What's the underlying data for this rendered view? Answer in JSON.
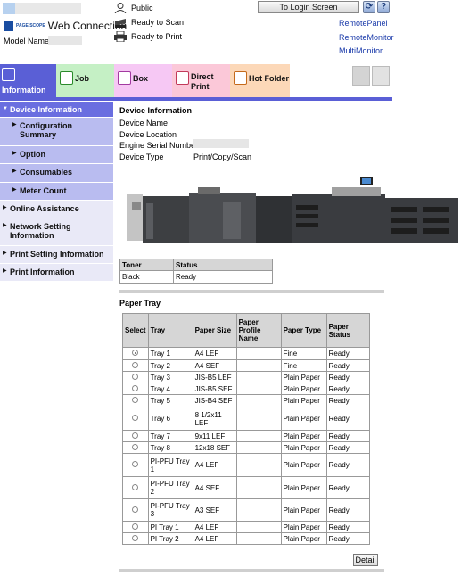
{
  "header": {
    "app_name": "Web Connection",
    "logo_small": "PAGE SCOPE",
    "model_label": "Model Name:",
    "user_status": "Public",
    "ready_scan": "Ready to Scan",
    "ready_print": "Ready to Print",
    "login_button": "To Login Screen",
    "links": [
      "RemotePanel",
      "RemoteMonitor",
      "MultiMonitor"
    ]
  },
  "tabs": [
    {
      "label": "Information",
      "icon": "information-icon",
      "color": "#5a5fd6"
    },
    {
      "label": "Job",
      "icon": "job-icon",
      "color": "#c5f0c5"
    },
    {
      "label": "Box",
      "icon": "box-icon",
      "color": "#f6c8f4"
    },
    {
      "label": "Direct Print",
      "line1": "Direct",
      "line2": "Print",
      "icon": "direct-print-icon",
      "color": "#fbc8d8"
    },
    {
      "label": "Hot Folder",
      "icon": "hot-folder-icon",
      "color": "#fcd8b8"
    }
  ],
  "sidebar": {
    "items": [
      {
        "label": "Device Information"
      },
      {
        "label": "Configuration Summary"
      },
      {
        "label": "Option"
      },
      {
        "label": "Consumables"
      },
      {
        "label": "Meter Count"
      },
      {
        "label": "Online Assistance"
      },
      {
        "label": "Network Setting Information"
      },
      {
        "label": "Print Setting Information"
      },
      {
        "label": "Print Information"
      }
    ]
  },
  "device": {
    "title": "Device Information",
    "name_label": "Device Name",
    "location_label": "Device Location",
    "serial_label": "Engine Serial Number",
    "type_label": "Device Type",
    "type_value": "Print/Copy/Scan"
  },
  "toner": {
    "headers": [
      "Toner",
      "Status"
    ],
    "rows": [
      [
        "Black",
        "Ready"
      ]
    ]
  },
  "paper_tray": {
    "title": "Paper Tray",
    "headers": [
      "Select",
      "Tray",
      "Paper Size",
      "Paper Profile Name",
      "Paper Type",
      "Paper Status"
    ],
    "rows": [
      {
        "selected": true,
        "tray": "Tray 1",
        "size": "A4 LEF",
        "profile": "",
        "type": "Fine",
        "status": "Ready"
      },
      {
        "selected": false,
        "tray": "Tray 2",
        "size": "A4 SEF",
        "profile": "",
        "type": "Fine",
        "status": "Ready"
      },
      {
        "selected": false,
        "tray": "Tray 3",
        "size": "JIS-B5 LEF",
        "profile": "",
        "type": "Plain Paper",
        "status": "Ready"
      },
      {
        "selected": false,
        "tray": "Tray 4",
        "size": "JIS-B5 SEF",
        "profile": "",
        "type": "Plain Paper",
        "status": "Ready"
      },
      {
        "selected": false,
        "tray": "Tray 5",
        "size": "JIS-B4 SEF",
        "profile": "",
        "type": "Plain Paper",
        "status": "Ready"
      },
      {
        "selected": false,
        "tray": "Tray 6",
        "size": "8 1/2x11 LEF",
        "profile": "",
        "type": "Plain Paper",
        "status": "Ready"
      },
      {
        "selected": false,
        "tray": "Tray 7",
        "size": "9x11 LEF",
        "profile": "",
        "type": "Plain Paper",
        "status": "Ready"
      },
      {
        "selected": false,
        "tray": "Tray 8",
        "size": "12x18 SEF",
        "profile": "",
        "type": "Plain Paper",
        "status": "Ready"
      },
      {
        "selected": false,
        "tray": "PI-PFU Tray 1",
        "size": "A4 LEF",
        "profile": "",
        "type": "Plain Paper",
        "status": "Ready"
      },
      {
        "selected": false,
        "tray": "PI-PFU Tray 2",
        "size": "A4 SEF",
        "profile": "",
        "type": "Plain Paper",
        "status": "Ready"
      },
      {
        "selected": false,
        "tray": "PI-PFU Tray 3",
        "size": "A3 SEF",
        "profile": "",
        "type": "Plain Paper",
        "status": "Ready"
      },
      {
        "selected": false,
        "tray": "PI Tray 1",
        "size": "A4 LEF",
        "profile": "",
        "type": "Plain Paper",
        "status": "Ready"
      },
      {
        "selected": false,
        "tray": "PI Tray 2",
        "size": "A4 LEF",
        "profile": "",
        "type": "Plain Paper",
        "status": "Ready"
      }
    ],
    "detail_button": "Detail"
  }
}
